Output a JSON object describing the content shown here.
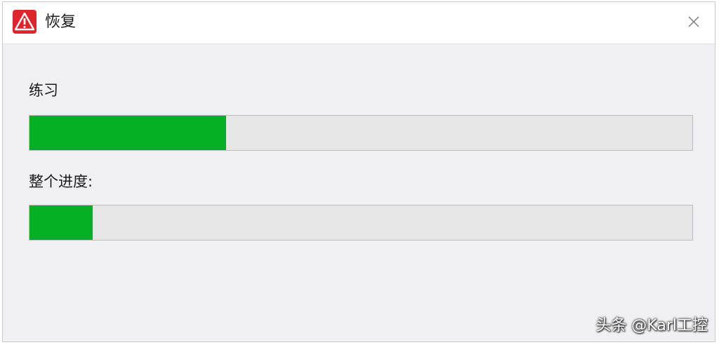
{
  "window": {
    "title": "恢复",
    "icon": "warning-triangle-icon",
    "close_icon": "close-icon",
    "accent_color": "#e0242c"
  },
  "task_progress": {
    "label": "练习",
    "fraction": 0.297
  },
  "overall_progress": {
    "label": "整个进度:",
    "fraction": 0.095
  },
  "colors": {
    "progress_fill": "#06b025",
    "progress_track": "#e6e6e6"
  },
  "watermark": "头条 @Karl工控"
}
